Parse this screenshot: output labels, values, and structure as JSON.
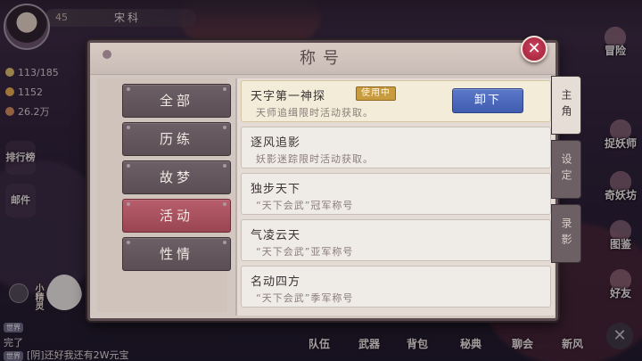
{
  "player": {
    "level": "45",
    "name": "宋科"
  },
  "resources": [
    {
      "value": "113/185",
      "icon": "stamina-icon",
      "color": "#e2c36a"
    },
    {
      "value": "1152",
      "icon": "gold-coin-icon",
      "color": "#e8b04a"
    },
    {
      "value": "26.2万",
      "icon": "copper-coin-icon",
      "color": "#d68f5a"
    }
  ],
  "left_sidebar": [
    "排行榜",
    "邮件"
  ],
  "right_sidebar": [
    "冒险",
    "捉妖师",
    "奇妖坊",
    "图鉴",
    "好友"
  ],
  "bottom_menu": [
    "队伍",
    "武器",
    "背包",
    "秘典",
    "聊会",
    "新风"
  ],
  "pet": {
    "label": "小精灵"
  },
  "chat": [
    {
      "tag": "世界",
      "text": "完了"
    },
    {
      "tag": "世界",
      "text": "[阴]还好我还有2W元宝"
    }
  ],
  "modal": {
    "title": "称号",
    "close_label": "✕",
    "categories": [
      {
        "label": "全部",
        "active": false
      },
      {
        "label": "历练",
        "active": false
      },
      {
        "label": "故梦",
        "active": false
      },
      {
        "label": "活动",
        "active": true
      },
      {
        "label": "性情",
        "active": false
      }
    ],
    "titles": [
      {
        "name": "天字第一神探",
        "desc": "天师追缉限时活动获取。",
        "badge": "使用中",
        "button": "卸下",
        "equipped": true
      },
      {
        "name": "逐风追影",
        "desc": "妖影迷踪限时活动获取。",
        "equipped": false
      },
      {
        "name": "独步天下",
        "desc": "“天下会武”冠军称号",
        "equipped": false
      },
      {
        "name": "气凌云天",
        "desc": "“天下会武”亚军称号",
        "equipped": false
      },
      {
        "name": "名动四方",
        "desc": "“天下会武”季军称号",
        "equipped": false
      }
    ],
    "side_tabs": [
      {
        "label": "主角",
        "active": true
      },
      {
        "label": "设定",
        "active": false
      },
      {
        "label": "录影",
        "active": false
      }
    ]
  },
  "colors": {
    "active_tab": "#b85e6c",
    "unequip_button": "#4a67bd",
    "in_use_badge": "#c89b3e",
    "close_button": "#c2344f"
  }
}
